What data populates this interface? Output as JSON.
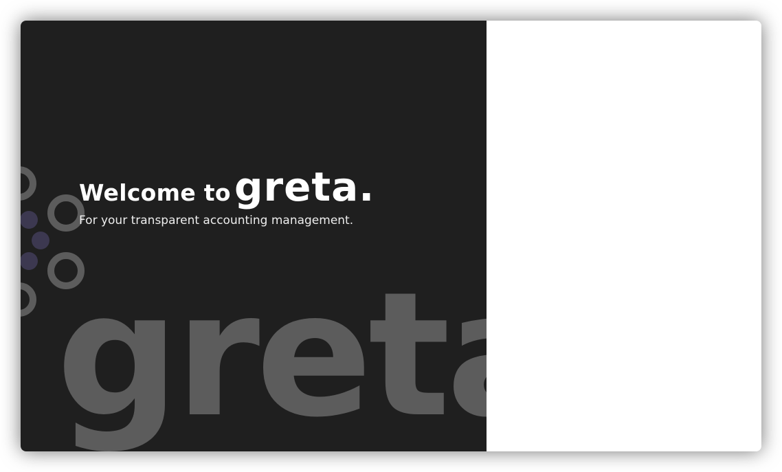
{
  "welcome": {
    "prefix": "Welcome to",
    "brand": "greta."
  },
  "tagline": "For your transparent accounting management.",
  "watermark": "greta",
  "colors": {
    "left_panel_bg": "#1f1f1f",
    "watermark": "#5c5c5c",
    "ring": "#5c5c5c",
    "dot": "#3c3850",
    "right_panel_bg": "#ffffff"
  }
}
